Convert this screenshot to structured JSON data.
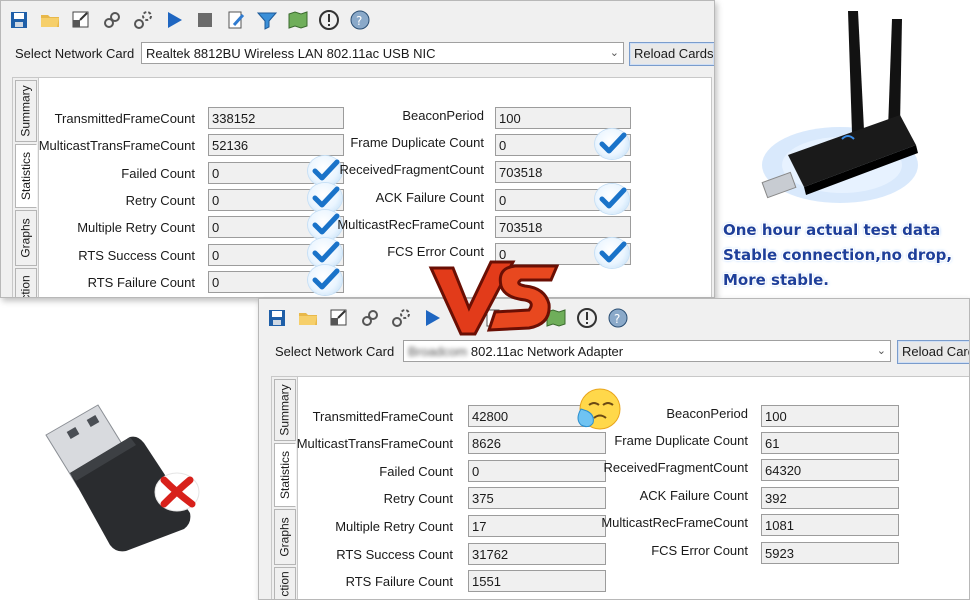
{
  "toolbar_icons": [
    "save-icon",
    "open-folder-icon",
    "export-icon",
    "link-icon",
    "settings-link-icon",
    "play-icon",
    "stop-icon",
    "edit-icon",
    "filter-icon",
    "map-icon",
    "info-icon",
    "help-globe-icon"
  ],
  "window_top": {
    "select_card_label": "Select Network Card",
    "card_name": "Realtek 8812BU Wireless LAN 802.11ac USB NIC",
    "reload_button": "Reload Cards",
    "tabs": [
      "Summary",
      "Statistics",
      "Graphs",
      "ction"
    ],
    "left_stats": [
      {
        "label": "TransmittedFrameCount",
        "value": "338152",
        "check": false
      },
      {
        "label": "MulticastTransFrameCount",
        "value": "52136",
        "check": false
      },
      {
        "label": "Failed Count",
        "value": "0",
        "check": true
      },
      {
        "label": "Retry Count",
        "value": "0",
        "check": true
      },
      {
        "label": "Multiple Retry Count",
        "value": "0",
        "check": true
      },
      {
        "label": "RTS Success Count",
        "value": "0",
        "check": true
      },
      {
        "label": "RTS Failure Count",
        "value": "0",
        "check": true
      }
    ],
    "right_stats": [
      {
        "label": "BeaconPeriod",
        "value": "100",
        "check": false
      },
      {
        "label": "Frame Duplicate Count",
        "value": "0",
        "check": true
      },
      {
        "label": "ReceivedFragmentCount",
        "value": "703518",
        "check": false
      },
      {
        "label": "ACK Failure Count",
        "value": "0",
        "check": true
      },
      {
        "label": "MulticastRecFrameCount",
        "value": "703518",
        "check": false
      },
      {
        "label": "FCS Error Count",
        "value": "0",
        "check": true
      }
    ]
  },
  "window_bottom": {
    "select_card_label": "Select Network Card",
    "card_name_blurred": "Broadcom",
    "card_name": "802.11ac Network Adapter",
    "reload_button": "Reload Card",
    "tabs": [
      "Summary",
      "Statistics",
      "Graphs",
      "ction"
    ],
    "left_stats": [
      {
        "label": "TransmittedFrameCount",
        "value": "42800"
      },
      {
        "label": "MulticastTransFrameCount",
        "value": "8626"
      },
      {
        "label": "Failed Count",
        "value": "0"
      },
      {
        "label": "Retry Count",
        "value": "375"
      },
      {
        "label": "Multiple Retry Count",
        "value": "17"
      },
      {
        "label": "RTS Success Count",
        "value": "31762"
      },
      {
        "label": "RTS Failure Count",
        "value": "1551"
      }
    ],
    "right_stats": [
      {
        "label": "BeaconPeriod",
        "value": "100"
      },
      {
        "label": "Frame Duplicate Count",
        "value": "61"
      },
      {
        "label": "ReceivedFragmentCount",
        "value": "64320"
      },
      {
        "label": "ACK Failure Count",
        "value": "392"
      },
      {
        "label": "MulticastRecFrameCount",
        "value": "1081"
      },
      {
        "label": "FCS Error Count",
        "value": "5923"
      }
    ]
  },
  "vs_text": "VS",
  "caption_lines": [
    "One hour actual test data",
    "Stable connection,no drop,",
    "More stable."
  ],
  "colors": {
    "caption": "#1e3f9a",
    "check": "#1a73c9",
    "vs_red": "#e23b1a",
    "x_red": "#d8211b"
  }
}
